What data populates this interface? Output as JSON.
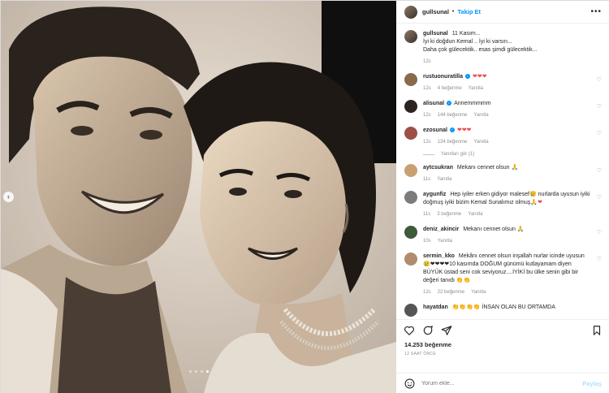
{
  "post": {
    "author": "gullsunal",
    "separator": "•",
    "follow_label": "Takip Et",
    "more_label": "•••",
    "caption_user": "gullsunal",
    "caption_text": "11 Kasım...\nİyi ki doğdun Kemal .. İyi ki varsın...\nDaha çok gülecektik.. esas şimdi gülecektik...",
    "caption_time": "12s"
  },
  "comments": [
    {
      "user": "rustuonuratilla",
      "verified": true,
      "text": "",
      "hearts": "❤❤❤",
      "time": "12s",
      "likes": "4 beğenme",
      "reply": "Yanıtla",
      "avatar": "#8a6a4a"
    },
    {
      "user": "alisunal",
      "verified": true,
      "text": "Annemmmmm",
      "hearts": "",
      "time": "12s",
      "likes": "144 beğenme",
      "reply": "Yanıtla",
      "avatar": "#2c2420"
    },
    {
      "user": "ezosunal",
      "verified": true,
      "text": "",
      "hearts": "❤❤❤",
      "time": "12s",
      "likes": "134 beğenme",
      "reply": "Yanıtla",
      "avatar": "#9c5048"
    },
    {
      "user": "aytcsukran",
      "verified": false,
      "text": "Mekanı cennet olsun 🙏",
      "hearts": "",
      "time": "11s",
      "likes": "",
      "reply": "Yanıtla",
      "avatar": "#c9a070"
    },
    {
      "user": "aygunfiz",
      "verified": false,
      "text": "Hep iyiler erken gidiyor malesef😢 nurlarda uyusun iyiki doğmuş iyiki bizim Kemal Sunalımız olmuş🙏",
      "hearts": "❤",
      "time": "11s",
      "likes": "3 beğenme",
      "reply": "Yanıtla",
      "avatar": "#7c7c7c"
    },
    {
      "user": "deniz_akincir",
      "verified": false,
      "text": "Mekanı cennet olsun 🙏",
      "hearts": "",
      "time": "10s",
      "likes": "",
      "reply": "Yanıtla",
      "avatar": "#3f5a3a"
    },
    {
      "user": "sermin_kko",
      "verified": false,
      "text": "Mekânı cennet olsun inşallah nurlar icinde uyusun 😢❤❤❤❤10 kasımda DOĞUM günümü kutlayamam diyen BÜYÜK üstad seni cok seviyoruz....İYİKİ bu ülke senin gibi bir değeri tanıdı 👏👏",
      "hearts": "",
      "time": "12s",
      "likes": "22 beğenme",
      "reply": "Yanıtla",
      "avatar": "#b08c6c"
    },
    {
      "user": "hayatdan",
      "verified": false,
      "text": "👏👏👏👏 İNSAN OLAN BU ORTAMDA",
      "hearts": "",
      "time": "",
      "likes": "",
      "reply": "",
      "avatar": "#555555"
    }
  ],
  "view_replies_label": "Yanıtları gör (1)",
  "likes_label": "14.253 beğenme",
  "post_time": "12 SAAT ÖNCE",
  "add_comment": {
    "placeholder": "Yorum ekle...",
    "post_label": "Paylaş"
  },
  "carousel": {
    "total": 4,
    "active_index": 3
  },
  "icons": [
    "heart-icon",
    "comment-icon",
    "share-icon",
    "save-icon",
    "emoji-icon",
    "chevron-left-icon"
  ],
  "colors": {
    "accent": "#0095f6",
    "like": "#ed4956",
    "muted": "#8e8e8e"
  }
}
